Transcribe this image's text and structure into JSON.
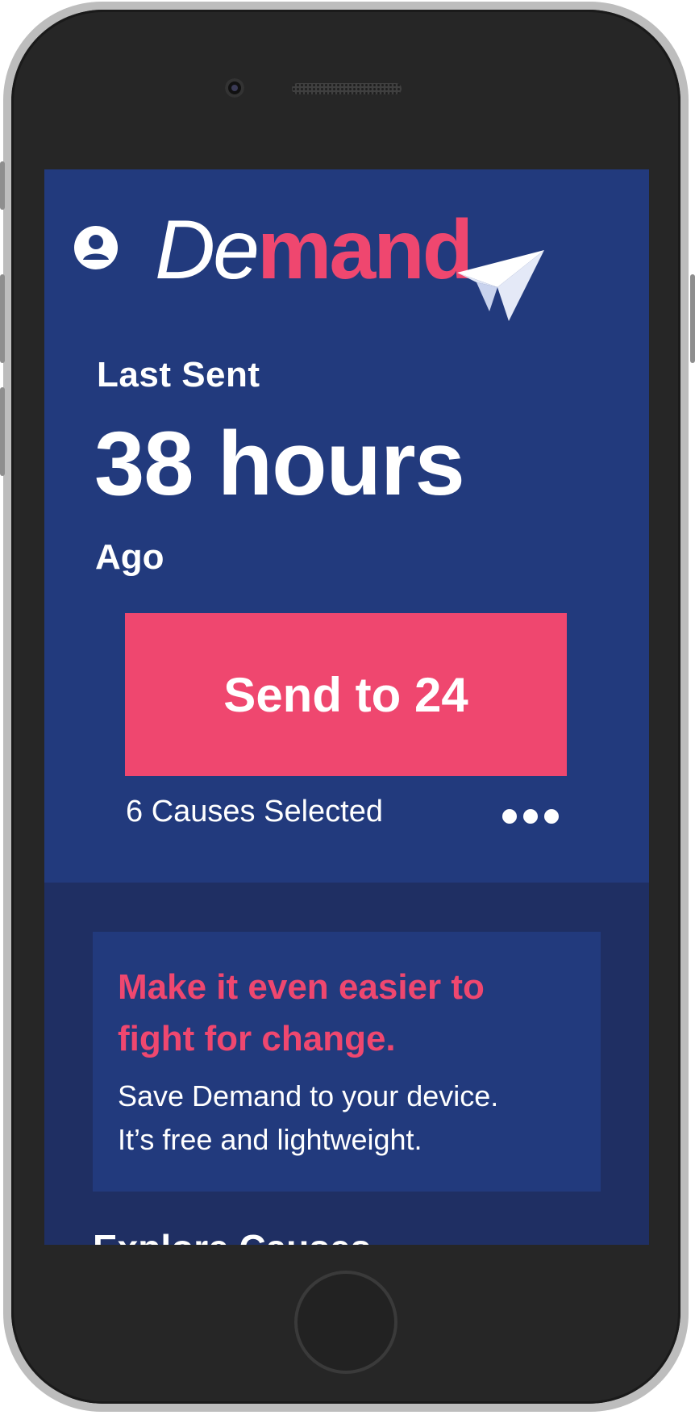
{
  "app": {
    "logo_prefix": "De",
    "logo_suffix": "mand"
  },
  "status": {
    "last_sent_label": "Last Sent",
    "elapsed": "38 hours",
    "ago_label": "Ago"
  },
  "send": {
    "button_label": "Send to 24",
    "causes_selected": "6 Causes Selected"
  },
  "install_prompt": {
    "headline": "Make it even easier to fight for change.",
    "body_line1": "Save Demand to your device.",
    "body_line2": "It’s free and lightweight."
  },
  "explore": {
    "title": "Explore Causes"
  },
  "icons": {
    "profile": "user-circle-icon",
    "logo_mark": "paper-plane-icon",
    "more": "more-dots-icon"
  },
  "colors": {
    "primary_bg": "#223a7d",
    "secondary_bg": "#1f2f63",
    "accent": "#ef476f",
    "text": "#ffffff"
  }
}
